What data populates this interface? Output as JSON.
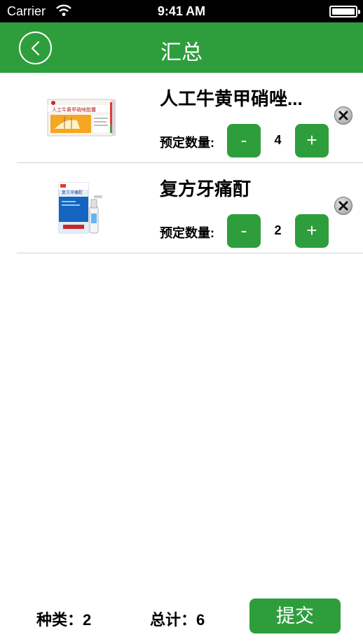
{
  "status_bar": {
    "carrier": "Carrier",
    "time": "9:41 AM"
  },
  "nav": {
    "title": "汇总",
    "back_icon": "chevron-left-icon"
  },
  "items": [
    {
      "name": "人工牛黄甲硝唑...",
      "qty_label": "预定数量:",
      "quantity": "4",
      "minus_label": "-",
      "plus_label": "+",
      "package_text": "人工牛黄甲硝唑胶囊"
    },
    {
      "name": "复方牙痛酊",
      "qty_label": "预定数量:",
      "quantity": "2",
      "minus_label": "-",
      "plus_label": "+",
      "package_text": "复方牙痛酊"
    }
  ],
  "footer": {
    "kinds_text": "种类：2",
    "total_text": "总计：6",
    "submit_label": "提交"
  },
  "colors": {
    "accent": "#2e9e3c",
    "divider": "#d0d0d0"
  }
}
